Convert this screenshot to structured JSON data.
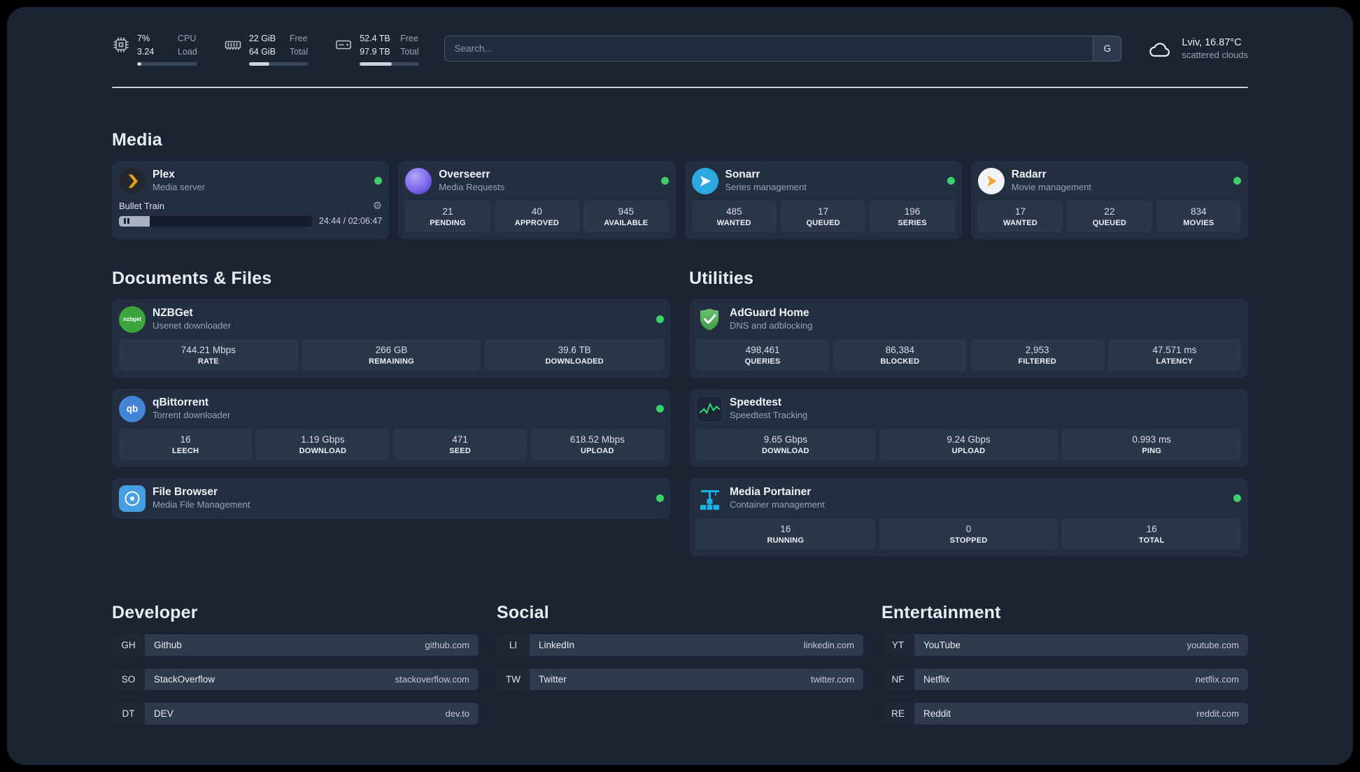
{
  "colors": {
    "status_online": "#3ecf6a"
  },
  "topbar": {
    "resources": [
      {
        "icon": "cpu-icon",
        "values": [
          "7%",
          "3.24"
        ],
        "labels": [
          "CPU",
          "Load"
        ],
        "progress_pct": 7
      },
      {
        "icon": "memory-icon",
        "values": [
          "22 GiB",
          "64 GiB"
        ],
        "labels": [
          "Free",
          "Total"
        ],
        "progress_pct": 34
      },
      {
        "icon": "disk-icon",
        "values": [
          "52.4 TB",
          "97.9 TB"
        ],
        "labels": [
          "Free",
          "Total"
        ],
        "progress_pct": 54
      }
    ],
    "search": {
      "placeholder": "Search...",
      "provider": "G"
    },
    "weather": {
      "location": "Lviv, 16.87°C",
      "condition": "scattered clouds"
    }
  },
  "sections": {
    "media": "Media",
    "documents": "Documents & Files",
    "utilities": "Utilities"
  },
  "apps": {
    "plex": {
      "name": "Plex",
      "subtitle": "Media server",
      "status": "online",
      "icon_text": "",
      "player": {
        "title": "Bullet Train",
        "time": "24:44 / 02:06:47",
        "progress_pct": 16
      }
    },
    "overseerr": {
      "name": "Overseerr",
      "subtitle": "Media Requests",
      "status": "online",
      "stats": [
        {
          "value": "21",
          "label": "PENDING"
        },
        {
          "value": "40",
          "label": "APPROVED"
        },
        {
          "value": "945",
          "label": "AVAILABLE"
        }
      ]
    },
    "sonarr": {
      "name": "Sonarr",
      "subtitle": "Series management",
      "status": "online",
      "stats": [
        {
          "value": "485",
          "label": "WANTED"
        },
        {
          "value": "17",
          "label": "QUEUED"
        },
        {
          "value": "196",
          "label": "SERIES"
        }
      ]
    },
    "radarr": {
      "name": "Radarr",
      "subtitle": "Movie management",
      "status": "online",
      "stats": [
        {
          "value": "17",
          "label": "WANTED"
        },
        {
          "value": "22",
          "label": "QUEUED"
        },
        {
          "value": "834",
          "label": "MOVIES"
        }
      ]
    },
    "nzbget": {
      "name": "NZBGet",
      "subtitle": "Usenet downloader",
      "status": "online",
      "icon_text": "nzbget",
      "stats": [
        {
          "value": "744.21 Mbps",
          "label": "RATE"
        },
        {
          "value": "266 GB",
          "label": "REMAINING"
        },
        {
          "value": "39.6 TB",
          "label": "DOWNLOADED"
        }
      ]
    },
    "qbittorrent": {
      "name": "qBittorrent",
      "subtitle": "Torrent downloader",
      "status": "online",
      "icon_text": "qb",
      "stats": [
        {
          "value": "16",
          "label": "LEECH"
        },
        {
          "value": "1.19 Gbps",
          "label": "DOWNLOAD"
        },
        {
          "value": "471",
          "label": "SEED"
        },
        {
          "value": "618.52 Mbps",
          "label": "UPLOAD"
        }
      ]
    },
    "filebrowser": {
      "name": "File Browser",
      "subtitle": "Media File Management",
      "status": "online"
    },
    "adguard": {
      "name": "AdGuard Home",
      "subtitle": "DNS and adblocking",
      "stats": [
        {
          "value": "498,461",
          "label": "QUERIES"
        },
        {
          "value": "86,384",
          "label": "BLOCKED"
        },
        {
          "value": "2,953",
          "label": "FILTERED"
        },
        {
          "value": "47.571 ms",
          "label": "LATENCY"
        }
      ]
    },
    "speedtest": {
      "name": "Speedtest",
      "subtitle": "Speedtest Tracking",
      "stats": [
        {
          "value": "9.65 Gbps",
          "label": "DOWNLOAD"
        },
        {
          "value": "9.24 Gbps",
          "label": "UPLOAD"
        },
        {
          "value": "0.993 ms",
          "label": "PING"
        }
      ]
    },
    "portainer": {
      "name": "Media Portainer",
      "subtitle": "Container management",
      "status": "online",
      "stats": [
        {
          "value": "16",
          "label": "RUNNING"
        },
        {
          "value": "0",
          "label": "STOPPED"
        },
        {
          "value": "16",
          "label": "TOTAL"
        }
      ]
    }
  },
  "bookmark_groups": [
    {
      "title": "Developer",
      "items": [
        {
          "abbr": "GH",
          "name": "Github",
          "domain": "github.com"
        },
        {
          "abbr": "SO",
          "name": "StackOverflow",
          "domain": "stackoverflow.com"
        },
        {
          "abbr": "DT",
          "name": "DEV",
          "domain": "dev.to"
        }
      ]
    },
    {
      "title": "Social",
      "items": [
        {
          "abbr": "LI",
          "name": "LinkedIn",
          "domain": "linkedin.com"
        },
        {
          "abbr": "TW",
          "name": "Twitter",
          "domain": "twitter.com"
        }
      ]
    },
    {
      "title": "Entertainment",
      "items": [
        {
          "abbr": "YT",
          "name": "YouTube",
          "domain": "youtube.com"
        },
        {
          "abbr": "NF",
          "name": "Netflix",
          "domain": "netflix.com"
        },
        {
          "abbr": "RE",
          "name": "Reddit",
          "domain": "reddit.com"
        }
      ]
    }
  ]
}
